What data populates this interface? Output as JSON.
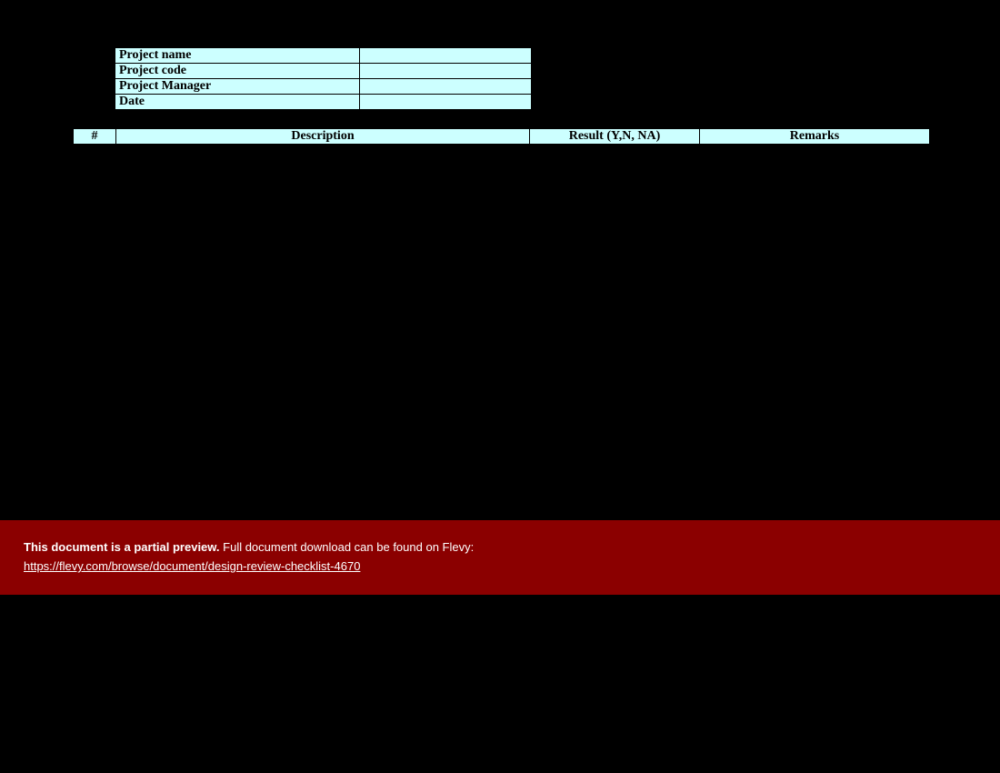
{
  "info": {
    "rows": [
      {
        "label": "Project name",
        "value": ""
      },
      {
        "label": "Project code",
        "value": ""
      },
      {
        "label": "Project Manager",
        "value": ""
      },
      {
        "label": "Date",
        "value": ""
      }
    ]
  },
  "checklist": {
    "headers": {
      "num": "#",
      "description": "Description",
      "result": "Result (Y,N, NA)",
      "remarks": "Remarks"
    }
  },
  "banner": {
    "bold": "This document is a partial preview.",
    "rest": "  Full document download can be found on Flevy:",
    "link": "https://flevy.com/browse/document/design-review-checklist-4670"
  }
}
